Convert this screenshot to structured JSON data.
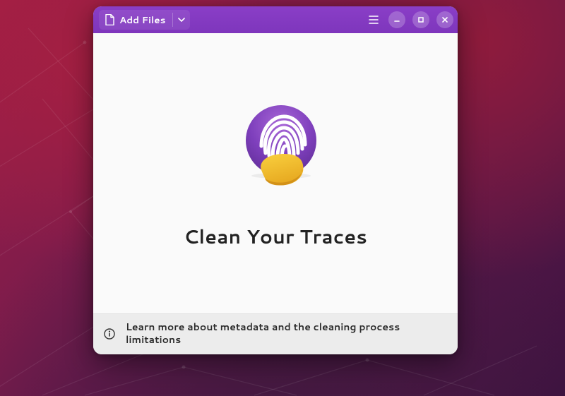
{
  "titlebar": {
    "add_files_label": "Add Files"
  },
  "content": {
    "title": "Clean Your Traces"
  },
  "footer": {
    "text": "Learn more about metadata and the cleaning process limitations"
  }
}
